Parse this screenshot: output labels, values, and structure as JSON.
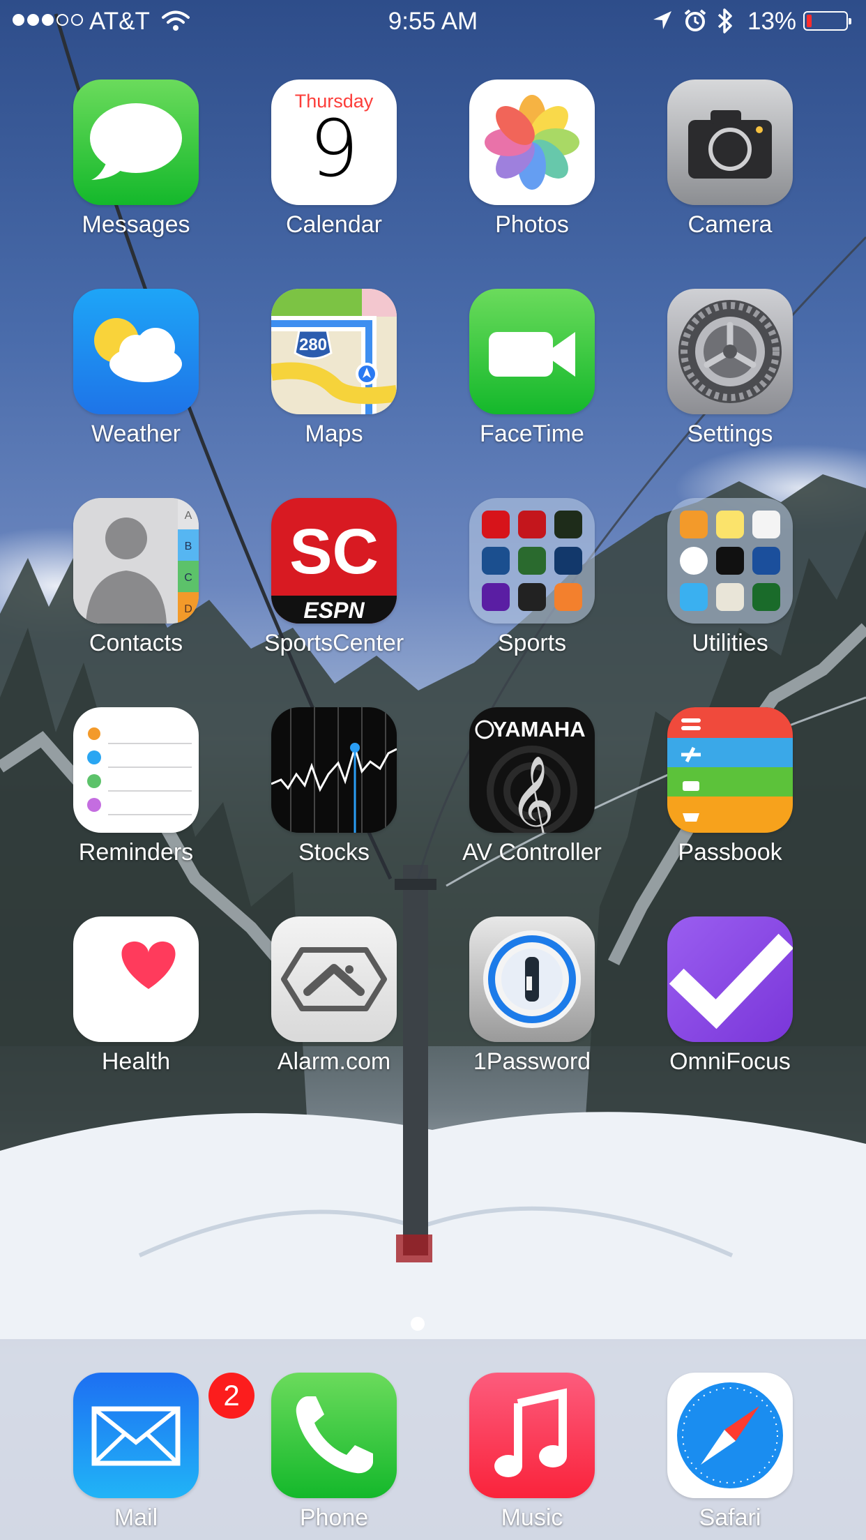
{
  "status_bar": {
    "carrier": "AT&T",
    "time": "9:55 AM",
    "battery_percent": "13%",
    "signal_bars": 3,
    "signal_total": 5,
    "battery_level": 0.13,
    "battery_color": "#ff2d2d",
    "icons": [
      "wifi-icon",
      "location-arrow-icon",
      "alarm-clock-icon",
      "bluetooth-icon",
      "battery-icon"
    ]
  },
  "apps": {
    "messages": "Messages",
    "calendar": "Calendar",
    "calendar_weekday": "Thursday",
    "calendar_date": "9",
    "photos": "Photos",
    "camera": "Camera",
    "weather": "Weather",
    "maps": "Maps",
    "maps_shield": "280",
    "facetime": "FaceTime",
    "settings": "Settings",
    "contacts": "Contacts",
    "contacts_tabs": [
      "A",
      "B",
      "C",
      "D"
    ],
    "sportscenter": "SportsCenter",
    "espn_logo": "SC",
    "espn_wordmark": "ESPN",
    "sports": "Sports",
    "utilities": "Utilities",
    "reminders": "Reminders",
    "stocks": "Stocks",
    "av_controller": "AV Controller",
    "yamaha_logo": "YAMAHA",
    "passbook": "Passbook",
    "health": "Health",
    "alarm_com": "Alarm.com",
    "onepassword": "1Password",
    "omnifocus": "OmniFocus"
  },
  "dock": {
    "mail": "Mail",
    "mail_badge": "2",
    "phone": "Phone",
    "music": "Music",
    "safari": "Safari"
  },
  "page_indicator": {
    "pages": 1,
    "current": 1
  }
}
